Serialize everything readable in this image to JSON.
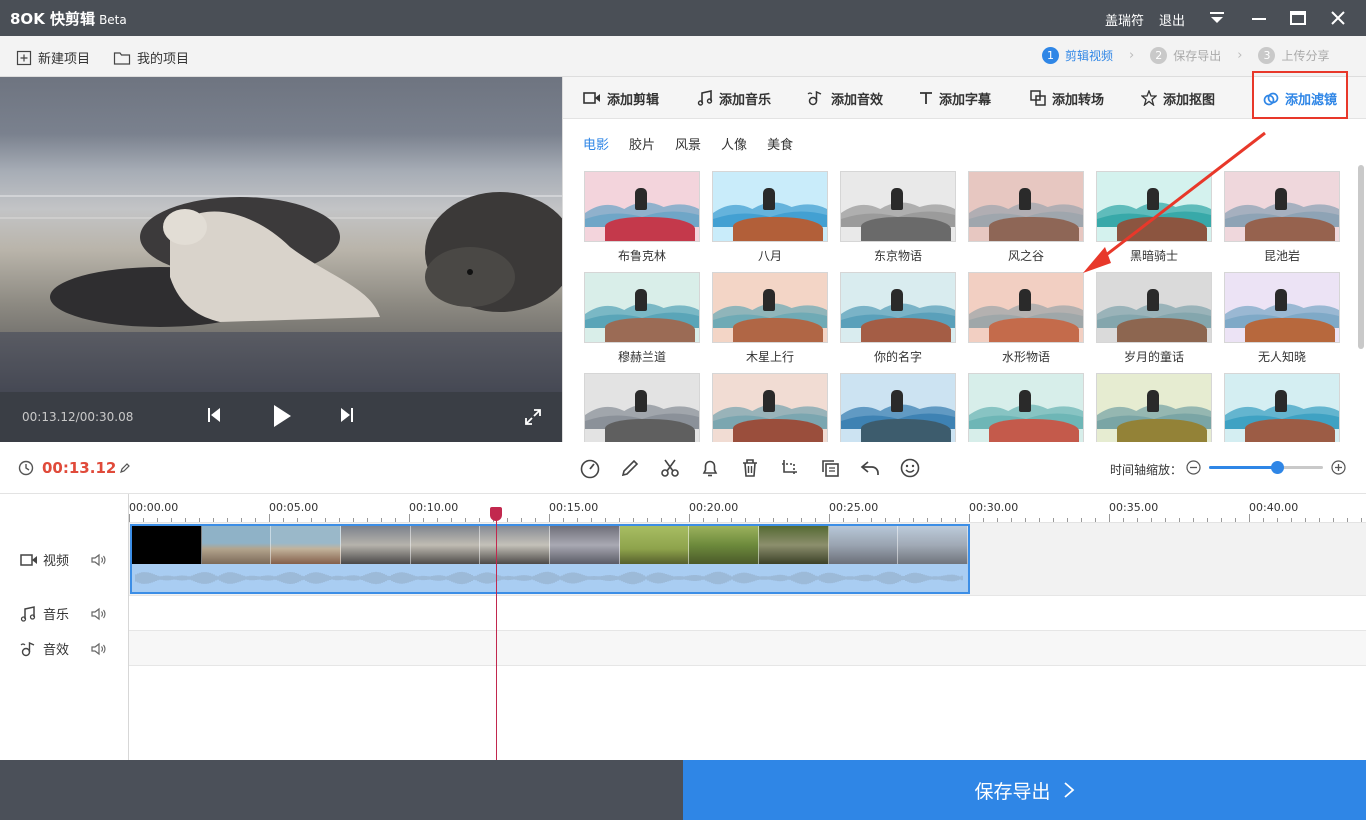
{
  "app": {
    "name": "快剪辑",
    "badge": "Beta",
    "user": "盖瑞符",
    "logout": "退出"
  },
  "toolbar": {
    "new_project": "新建项目",
    "my_projects": "我的项目"
  },
  "steps": [
    {
      "num": "1",
      "label": "剪辑视频",
      "active": true
    },
    {
      "num": "2",
      "label": "保存导出",
      "active": false
    },
    {
      "num": "3",
      "label": "上传分享",
      "active": false
    }
  ],
  "player": {
    "time": "00:13.12/00:30.08"
  },
  "tabs": [
    {
      "label": "添加剪辑",
      "icon": "video-camera-icon"
    },
    {
      "label": "添加音乐",
      "icon": "music-note-icon"
    },
    {
      "label": "添加音效",
      "icon": "sound-effect-icon"
    },
    {
      "label": "添加字幕",
      "icon": "text-icon"
    },
    {
      "label": "添加转场",
      "icon": "transition-icon"
    },
    {
      "label": "添加抠图",
      "icon": "cutout-star-icon"
    },
    {
      "label": "添加滤镜",
      "icon": "filter-icon",
      "active": true
    }
  ],
  "filter_categories": [
    {
      "label": "电影",
      "active": true
    },
    {
      "label": "胶片"
    },
    {
      "label": "风景"
    },
    {
      "label": "人像"
    },
    {
      "label": "美食"
    }
  ],
  "filters": [
    {
      "name": "布鲁克林",
      "sky": "#f3d4dc",
      "mtn": "#6fa6c7",
      "rock": "#c4394b"
    },
    {
      "name": "八月",
      "sky": "#c9ecfa",
      "mtn": "#43a0d2",
      "rock": "#b25f39"
    },
    {
      "name": "东京物语",
      "sky": "#e9e9e9",
      "mtn": "#9b9b9b",
      "rock": "#6a6a6a"
    },
    {
      "name": "风之谷",
      "sky": "#e7c7c1",
      "mtn": "#9fa6ad",
      "rock": "#8e6656"
    },
    {
      "name": "黑暗骑士",
      "sky": "#d4f2ee",
      "mtn": "#38a9a9",
      "rock": "#8c5540"
    },
    {
      "name": "昆池岩",
      "sky": "#efd7dc",
      "mtn": "#8ea3b5",
      "rock": "#96624e"
    },
    {
      "name": "穆赫兰道",
      "sky": "#d9eee9",
      "mtn": "#5aa5b8",
      "rock": "#9b6b55"
    },
    {
      "name": "木星上行",
      "sky": "#f3d5c6",
      "mtn": "#6faab5",
      "rock": "#b06645"
    },
    {
      "name": "你的名字",
      "sky": "#d9ecef",
      "mtn": "#5aa0ba",
      "rock": "#a45d45"
    },
    {
      "name": "水形物语",
      "sky": "#f2cfc2",
      "mtn": "#9fa7a9",
      "rock": "#c46b4b"
    },
    {
      "name": "岁月的童话",
      "sky": "#dadada",
      "mtn": "#84a6ad",
      "rock": "#8d6650"
    },
    {
      "name": "无人知晓",
      "sky": "#ece3f5",
      "mtn": "#7fa9c7",
      "rock": "#b7683d"
    },
    {
      "name": "",
      "sky": "#e3e3e3",
      "mtn": "#8b9199",
      "rock": "#5f5f5f"
    },
    {
      "name": "",
      "sky": "#f1dcd3",
      "mtn": "#7ba6b0",
      "rock": "#9a4e3c"
    },
    {
      "name": "",
      "sky": "#cce3f2",
      "mtn": "#3e82b3",
      "rock": "#3d5c6d"
    },
    {
      "name": "",
      "sky": "#d7eeea",
      "mtn": "#6eb6b6",
      "rock": "#c45a4b"
    },
    {
      "name": "",
      "sky": "#e6ecd1",
      "mtn": "#7aa5a5",
      "rock": "#938237"
    },
    {
      "name": "",
      "sky": "#d4eef2",
      "mtn": "#3fa2c3",
      "rock": "#9c5c45"
    }
  ],
  "edit": {
    "current_time": "00:13.12",
    "zoom_label": "时间轴缩放：",
    "zoom_level": 0.6,
    "tools": [
      "speed-icon",
      "pen-icon",
      "scissors-icon",
      "bell-icon",
      "trash-icon",
      "crop-rotate-icon",
      "copy-icon",
      "undo-icon",
      "smile-icon"
    ]
  },
  "timeline": {
    "ticks": [
      "00:00.00",
      "00:05.00",
      "00:10.00",
      "00:15.00",
      "00:20.00",
      "00:25.00",
      "00:30.00",
      "00:35.00",
      "00:40.00"
    ],
    "tracks": [
      {
        "label": "视频",
        "icon": "video-camera-icon"
      },
      {
        "label": "音乐",
        "icon": "music-note-icon"
      },
      {
        "label": "音效",
        "icon": "sound-effect-icon"
      }
    ]
  },
  "export_button": "保存导出",
  "colors": {
    "accent": "#2f86e6",
    "highlight": "#e8382a",
    "time_red": "#e04a3a"
  }
}
